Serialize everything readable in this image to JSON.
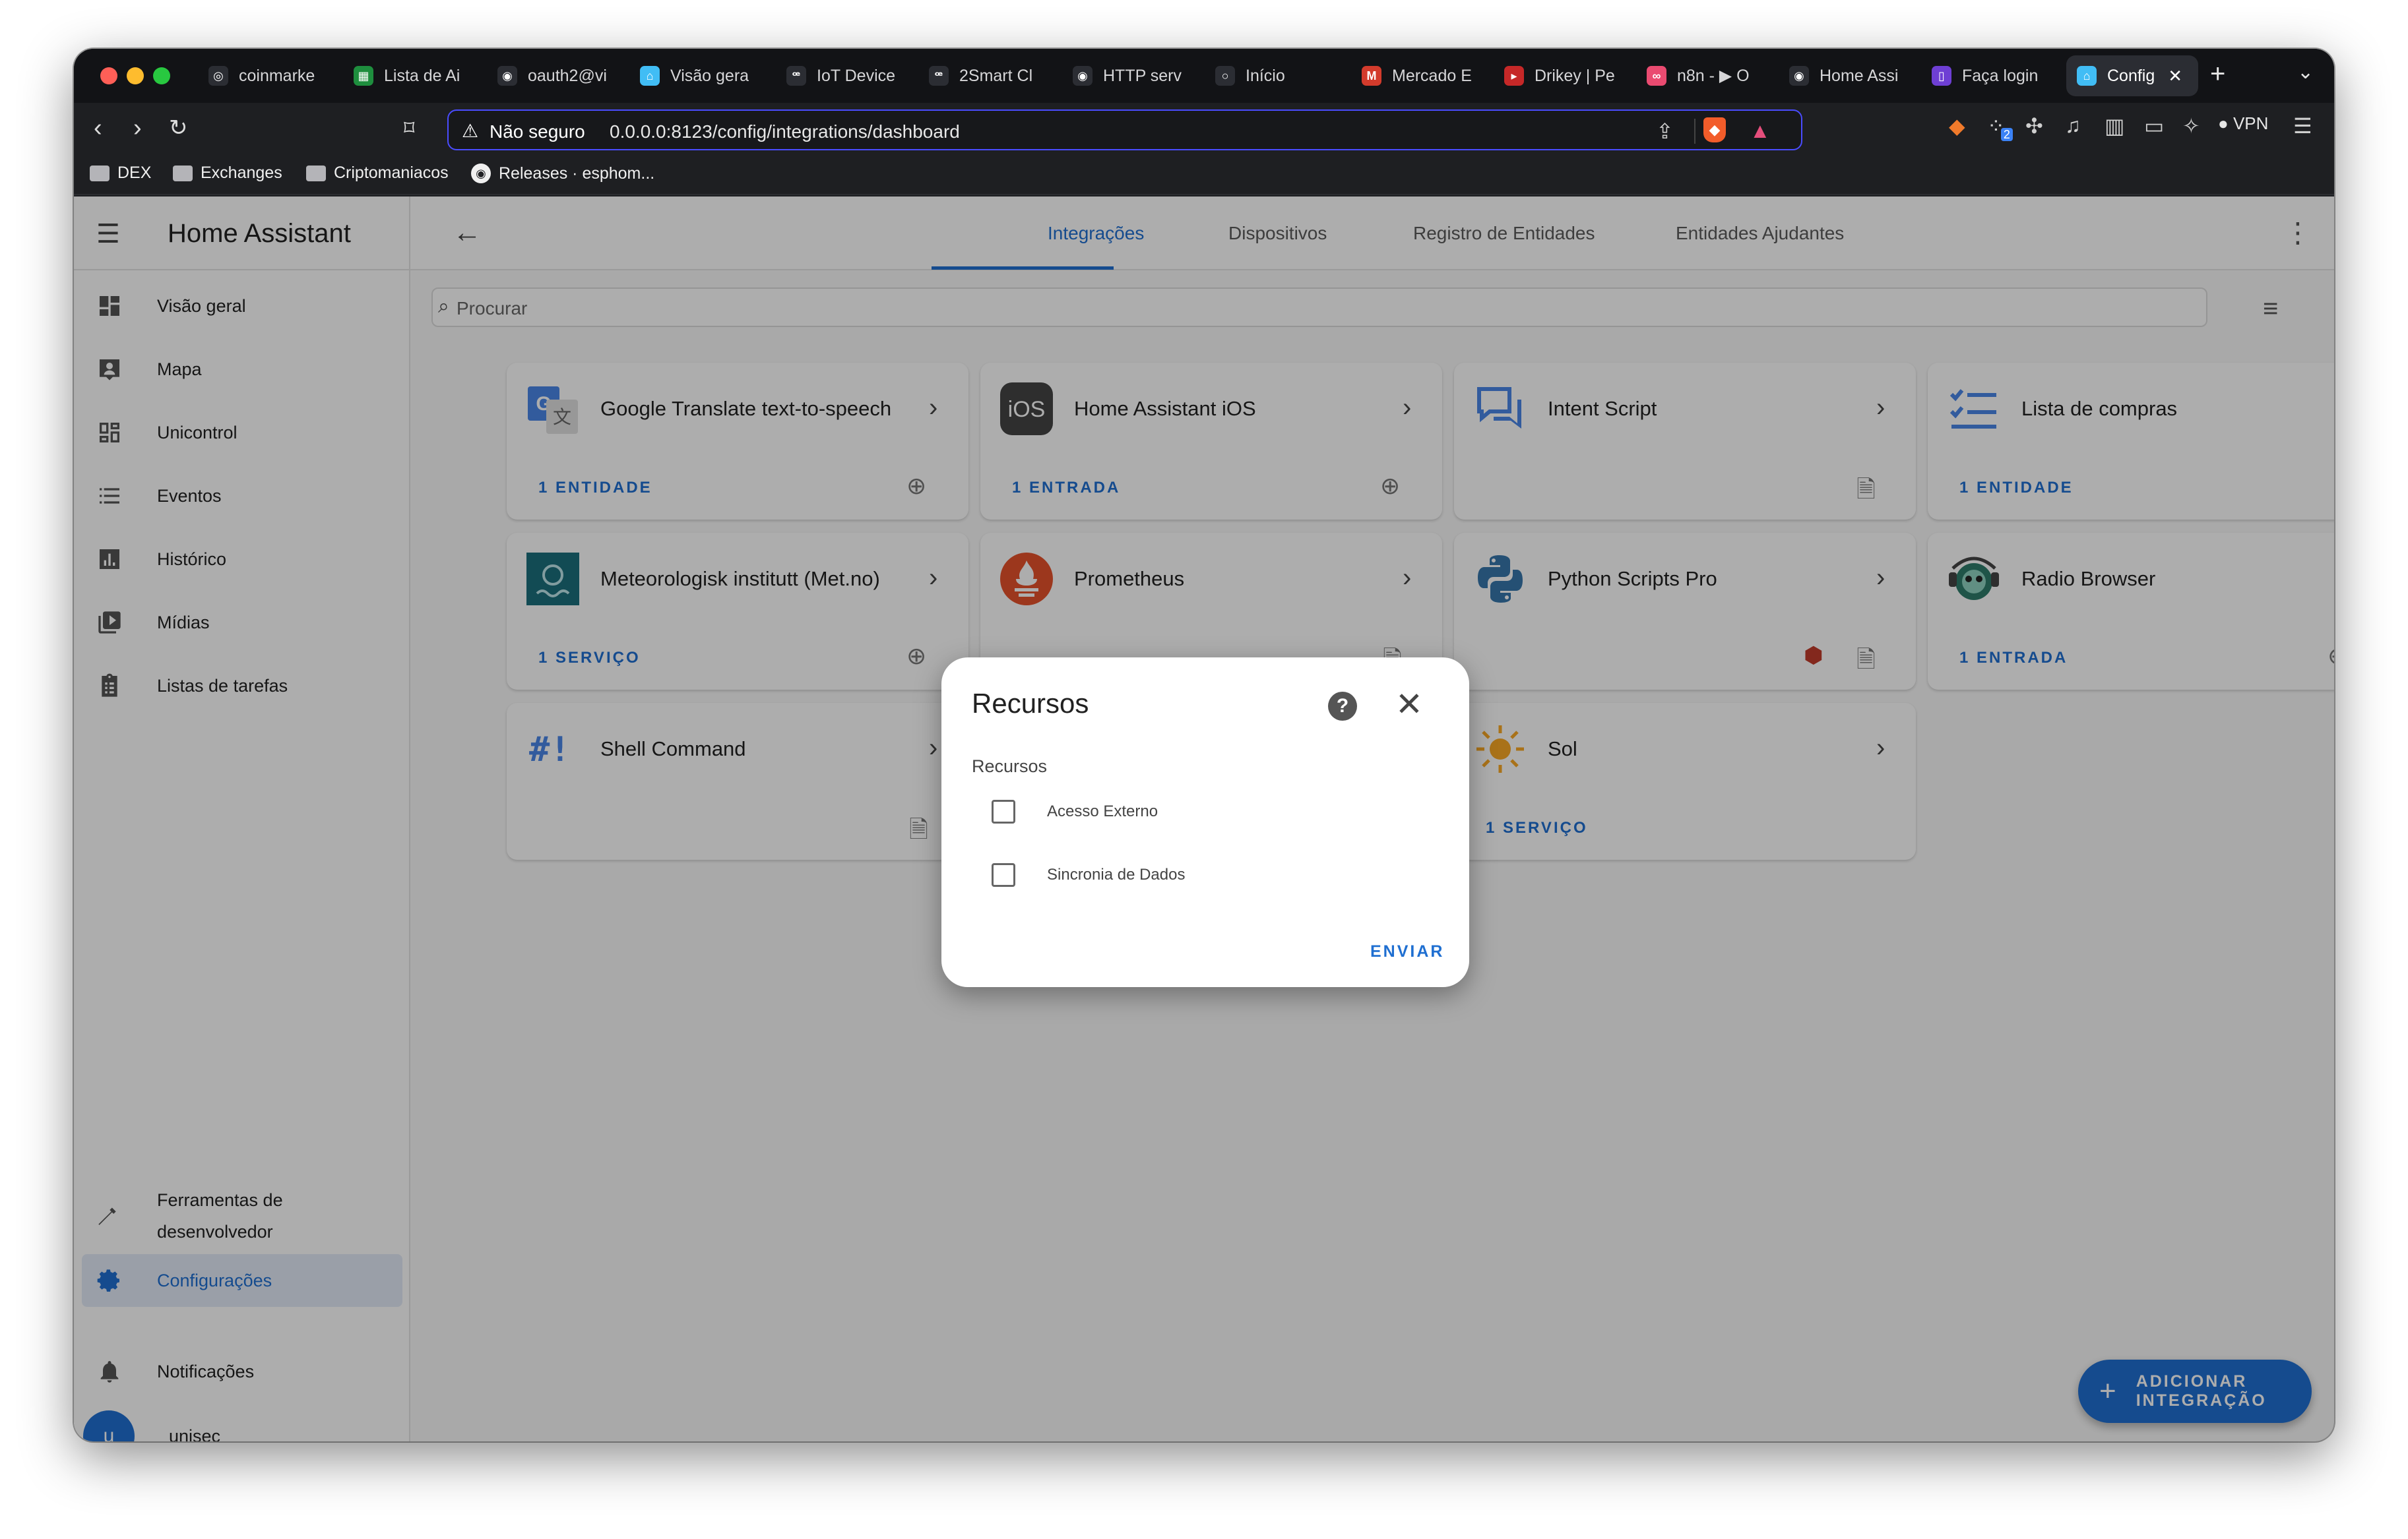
{
  "browser": {
    "tabs": [
      {
        "label": "coinmarke",
        "fav_color": "#2b2d33",
        "fav_text": "◎"
      },
      {
        "label": "Lista de Ai",
        "fav_color": "#1e8e3e",
        "fav_text": "▦"
      },
      {
        "label": "oauth2@vi",
        "fav_color": "#2b2d33",
        "fav_text": "◉"
      },
      {
        "label": "Visão gera",
        "fav_color": "#41bdf5",
        "fav_text": "⌂"
      },
      {
        "label": "IoT Device",
        "fav_color": "#2b2d33",
        "fav_text": "ꟹ"
      },
      {
        "label": "2Smart Cl",
        "fav_color": "#2b2d33",
        "fav_text": "ꟹ"
      },
      {
        "label": "HTTP serv",
        "fav_color": "#2b2d33",
        "fav_text": "◉"
      },
      {
        "label": "Início",
        "fav_color": "#2b2d33",
        "fav_text": "○"
      },
      {
        "label": "Mercado E",
        "fav_color": "#d33b2c",
        "fav_text": "M"
      },
      {
        "label": "Drikey | Pe",
        "fav_color": "#c62828",
        "fav_text": "▸"
      },
      {
        "label": "n8n - ▶ O",
        "fav_color": "#ea4b71",
        "fav_text": "∞"
      },
      {
        "label": "Home Assi",
        "fav_color": "#2b2d33",
        "fav_text": "◉"
      },
      {
        "label": "Faça login",
        "fav_color": "#6e3fd4",
        "fav_text": "▯"
      },
      {
        "label": "Config",
        "fav_color": "#41bdf5",
        "fav_text": "⌂",
        "active": true
      }
    ],
    "not_secure": "Não seguro",
    "url": "0.0.0.0:8123/config/integrations/dashboard",
    "vpn": "VPN",
    "ext_badge": "2",
    "bookmarks": [
      "DEX",
      "Exchanges",
      "Criptomaniacos",
      "Releases · esphom..."
    ]
  },
  "sidebar": {
    "title": "Home Assistant",
    "items": [
      {
        "label": "Visão geral",
        "icon": "dashboard-icon"
      },
      {
        "label": "Mapa",
        "icon": "map-icon"
      },
      {
        "label": "Unicontrol",
        "icon": "grid-icon"
      },
      {
        "label": "Eventos",
        "icon": "list-icon"
      },
      {
        "label": "Histórico",
        "icon": "chart-icon"
      },
      {
        "label": "Mídias",
        "icon": "media-icon"
      },
      {
        "label": "Listas de tarefas",
        "icon": "clipboard-icon"
      }
    ],
    "devtools": "Ferramentas de desenvolvedor",
    "settings": "Configurações",
    "notifications": "Notificações",
    "user": "unisec",
    "user_initial": "u"
  },
  "topbar": {
    "tabs": [
      "Integrações",
      "Dispositivos",
      "Registro de Entidades",
      "Entidades Ajudantes"
    ]
  },
  "search": {
    "placeholder": "Procurar"
  },
  "cards": [
    {
      "name": "Google Translate text-to-speech",
      "footer": "1 ENTIDADE"
    },
    {
      "name": "Home Assistant iOS",
      "footer": "1 ENTRADA"
    },
    {
      "name": "Intent Script",
      "footer": ""
    },
    {
      "name": "Lista de compras",
      "footer": "1 ENTIDADE"
    },
    {
      "name": "Meteorologisk institutt (Met.no)",
      "footer": "1 SERVIÇO"
    },
    {
      "name": "Prometheus",
      "footer": ""
    },
    {
      "name": "Python Scripts Pro",
      "footer": ""
    },
    {
      "name": "Radio Browser",
      "footer": "1 ENTRADA"
    },
    {
      "name": "Shell Command",
      "footer": ""
    },
    {
      "name": "Sol",
      "footer": "1 SERVIÇO"
    }
  ],
  "fab": {
    "label": "ADICIONAR INTEGRAÇÃO"
  },
  "dialog": {
    "title": "Recursos",
    "section": "Recursos",
    "options": [
      {
        "label": "Acesso Externo",
        "checked": false
      },
      {
        "label": "Sincronia de Dados",
        "checked": false
      }
    ],
    "submit": "ENVIAR"
  },
  "colors": {
    "accent": "#1f6fd1",
    "ha_blue": "#41bdf5",
    "scrim": "rgba(0,0,0,0.32)"
  }
}
